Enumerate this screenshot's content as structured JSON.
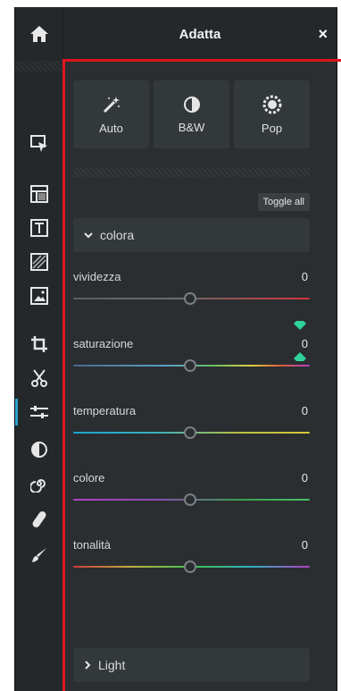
{
  "header": {
    "title": "Adatta",
    "close": "×"
  },
  "presets": [
    {
      "label": "Auto",
      "icon": "magic-wand-icon"
    },
    {
      "label": "B&W",
      "icon": "half-circle-icon"
    },
    {
      "label": "Pop",
      "icon": "pop-gear-icon"
    }
  ],
  "toggle_all": "Toggle all",
  "section_colora": {
    "label": "colora",
    "icon": "chevron-down-icon"
  },
  "sliders": [
    {
      "label": "vividezza",
      "value": "0",
      "track": "linear-gradient(90deg,#5a5f63 0%,#6a6e72 45%,#8a5a5a 60%,#d2323c 100%)"
    },
    {
      "label": "saturazione",
      "value": "0",
      "track": "linear-gradient(90deg,#4a6a8a 0%,#5aa0c8 40%,#6ac060 60%,#e0d040 75%,#e05a3a 88%,#b040c0 100%)"
    },
    {
      "label": "temperatura",
      "value": "0",
      "track": "linear-gradient(90deg,#1aa6d0 0%,#3ab0c0 35%,#b8c040 70%,#d8c83a 100%)"
    },
    {
      "label": "colore",
      "value": "0",
      "track": "linear-gradient(90deg,#b040c0 0%,#8a4ab0 35%,#3aa050 70%,#4ac060 100%)"
    },
    {
      "label": "tonalità",
      "value": "0",
      "track": "linear-gradient(90deg,#d03a3a 0%,#c0b040 25%,#40c050 50%,#30b0c0 75%,#b040c0 100%)"
    }
  ],
  "section_light": {
    "label": "Light",
    "icon": "chevron-right-icon"
  },
  "colors": {
    "accent": "#2aa0d0",
    "highlight": "#e0141e",
    "gem": "#2fd39a"
  }
}
